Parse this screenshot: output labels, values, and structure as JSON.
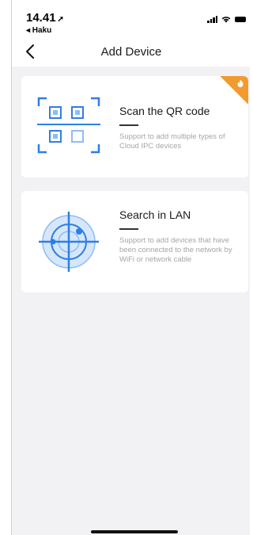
{
  "status_bar": {
    "time": "14.41",
    "location_glyph": "➚",
    "back_app": "◂ Haku",
    "icons": [
      "signal-icon",
      "wifi-icon",
      "battery-icon"
    ]
  },
  "nav": {
    "title": "Add Device",
    "back_icon": "chevron-left-icon"
  },
  "cards": [
    {
      "title": "Scan the QR code",
      "description": "Support to add multiple types of Cloud IPC devices",
      "icon": "qr-scan-icon",
      "badge": "hot-flame-icon"
    },
    {
      "title": "Search in LAN",
      "description": "Support to add devices that have been connected to the network by WiFi or network cable",
      "icon": "radar-search-icon"
    }
  ],
  "colors": {
    "accent_blue": "#2f7ee6",
    "light_blue": "#8fbcf5",
    "badge_orange": "#f29a2e",
    "background": "#f2f2f5"
  }
}
